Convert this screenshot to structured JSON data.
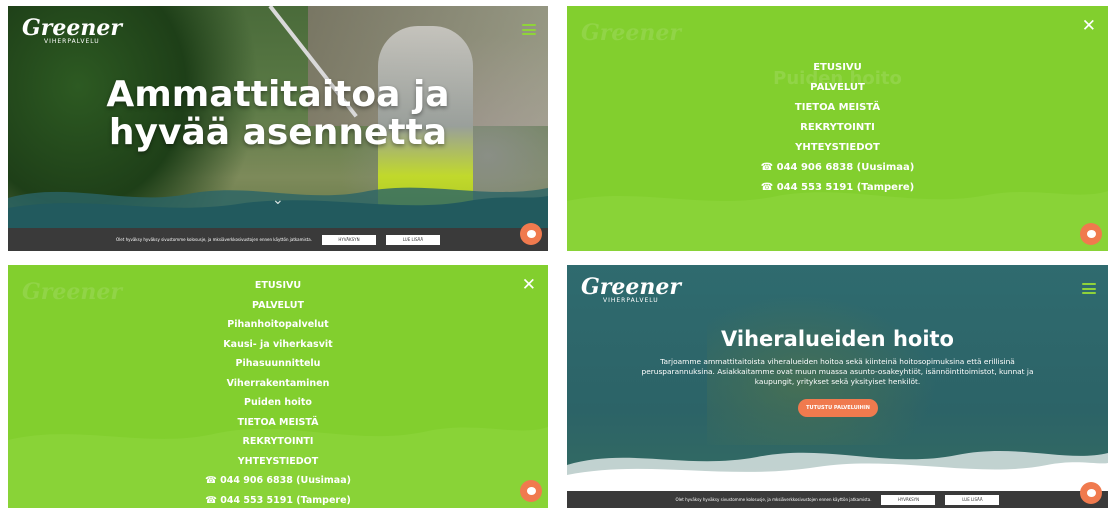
{
  "colors": {
    "green": "#82cf2e",
    "teal": "#2f6b6f",
    "orange": "#f07a4e",
    "cookie_bar": "#3a3a3a"
  },
  "logo": {
    "name": "Greener",
    "tagline": "VIHERPALVELU"
  },
  "hero": {
    "title_line1": "Ammattitaitoa ja",
    "title_line2": "hyvää asennetta"
  },
  "cookie": {
    "text": "Olet hyväksy hyväksy sivustomme kolosusje, ja mksiäverkkosivustojen ennen käyttön jatkamista.",
    "accept_label": "HYVÄKSYN",
    "read_more_label": "LUE LISÄÄ"
  },
  "menu_panel_2": {
    "ghost_title": "Puiden hoito",
    "items": [
      "ETUSIVU",
      "PALVELUT",
      "TIETOA MEISTÄ",
      "REKRYTOINTI",
      "YHTEYSTIEDOT"
    ],
    "phones": [
      "044 906 6838 (Uusimaa)",
      "044 553 5191 (Tampere)"
    ]
  },
  "menu_panel_3": {
    "items": [
      "ETUSIVU",
      "PALVELUT"
    ],
    "sub_items": [
      "Pihanhoitopalvelut",
      "Kausi- ja viherkasvit",
      "Pihasuunnittelu",
      "Viherrakentaminen",
      "Puiden hoito"
    ],
    "items_after": [
      "TIETOA MEISTÄ",
      "REKRYTOINTI",
      "YHTEYSTIEDOT"
    ],
    "phones": [
      "044 906 6838 (Uusimaa)",
      "044 553 5191 (Tampere)"
    ]
  },
  "viheralueet": {
    "title": "Viheralueiden hoito",
    "text": "Tarjoamme ammattitaitoista viheralueiden hoitoa sekä kiinteinä hoitosopimuksina että erillisinä perusparannuksina. Asiakkaitamme ovat muun muassa asunto-osakeyhtiöt, isännöintitoimistot, kunnat ja kaupungit, yritykset sekä yksityiset henkilöt.",
    "button_label": "TUTUSTU PALVELUIHIN"
  },
  "icons": [
    "hamburger-icon",
    "close-icon",
    "chevron-down-icon",
    "chat-icon",
    "phone-icon"
  ]
}
